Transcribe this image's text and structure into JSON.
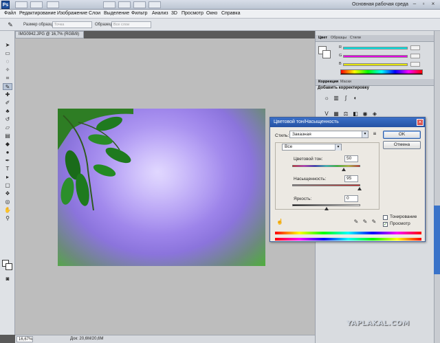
{
  "app": {
    "logo_text": "Ps",
    "workspace_label": "Основная рабочая среда",
    "window_controls": [
      "minimize-icon",
      "restore-icon",
      "close-icon"
    ]
  },
  "menu": [
    "Файл",
    "Редактирование",
    "Изображение",
    "Слои",
    "Выделение",
    "Фильтр",
    "Анализ",
    "3D",
    "Просмотр",
    "Окно",
    "Справка"
  ],
  "options_bar": {
    "tool_icon": "eyedropper-icon",
    "sample_size_label": "Размер образца:",
    "sample_size_value": "Точка",
    "sample_label": "Образец:",
    "sample_value": "Все слои"
  },
  "document": {
    "tab_title": "IMG0942.JPG @ 16,7% (RGB/8)",
    "zoom": "16,67%",
    "doc_size": "Док: 20,6M/20,6M"
  },
  "color_panel": {
    "tabs": [
      "Цвет",
      "Образцы",
      "Стили"
    ],
    "channels": [
      {
        "label": "R",
        "color": "#00e5e5"
      },
      {
        "label": "G",
        "color": "#e500e5"
      },
      {
        "label": "B",
        "color": "#e5e500"
      }
    ]
  },
  "adjustments_panel": {
    "tabs": [
      "Коррекция",
      "Маски"
    ],
    "title": "Добавить корректировку",
    "icons": [
      "vibrance-icon",
      "hue-saturation-icon",
      "color-balance-icon",
      "black-white-icon",
      "photo-filter-icon",
      "channel-mixer-icon"
    ]
  },
  "dialog": {
    "title": "Цветовой тон/Насыщенность",
    "style_label": "Стиль:",
    "style_value": "Заказная",
    "ok_label": "OK",
    "cancel_label": "Отмена",
    "range_value": "Все",
    "hue_label": "Цветовой тон:",
    "hue_value": "50",
    "saturation_label": "Насыщенность:",
    "saturation_value": "95",
    "lightness_label": "Яркость:",
    "lightness_value": "0",
    "colorize_label": "Тонирование",
    "colorize_checked": false,
    "preview_label": "Просмотр",
    "preview_checked": true
  },
  "watermark": "YAPLAKAL.COM"
}
